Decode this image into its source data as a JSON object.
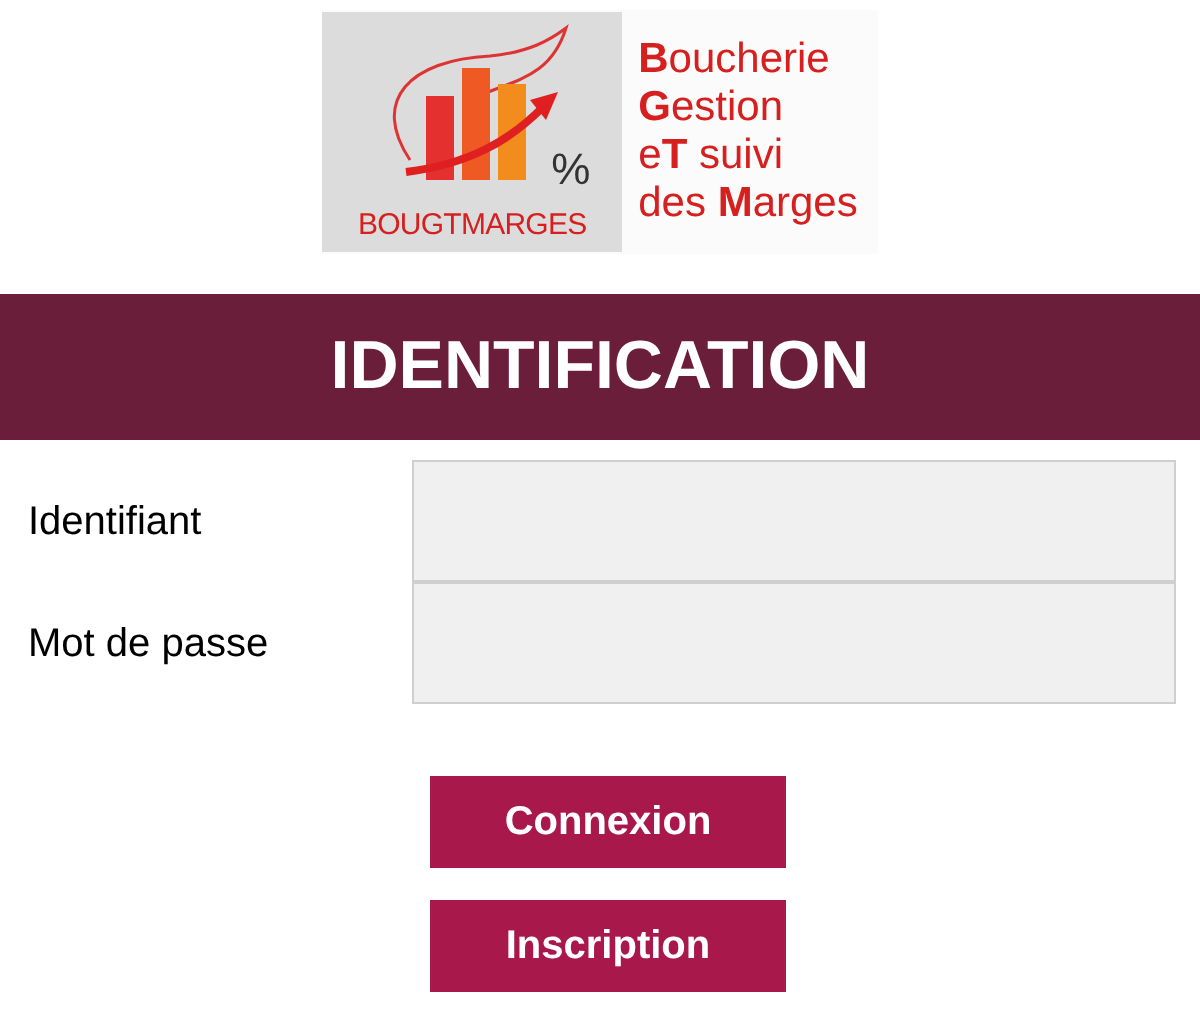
{
  "logo": {
    "wordmark": "BOUGTMARGES",
    "symbol": "%",
    "tagline": [
      "**B**oucherie",
      "**G**estion",
      "e**T** suivi",
      "des **M**arges"
    ]
  },
  "heading": "IDENTIFICATION",
  "fields": [
    {
      "label": "Identifiant"
    },
    {
      "label": "Mot de passe"
    }
  ],
  "buttons": [
    "Connexion",
    "Inscription"
  ]
}
